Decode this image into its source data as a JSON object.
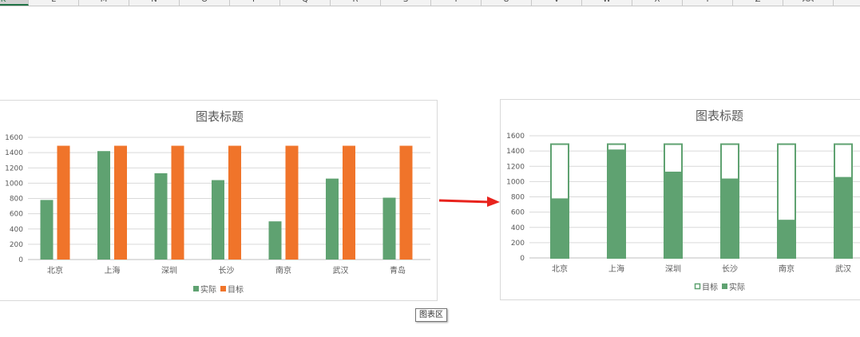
{
  "column_headers": [
    "K",
    "L",
    "M",
    "N",
    "O",
    "P",
    "Q",
    "R",
    "S",
    "T",
    "U",
    "V",
    "W",
    "X",
    "Y",
    "Z",
    "AA"
  ],
  "selected_column": "K",
  "tooltip": "图表区",
  "colors": {
    "actual": "#5fa271",
    "target": "#f0742a",
    "target_outline": "#5fa271",
    "arrow": "#e8231d",
    "grid": "#d9d9d9",
    "text": "#595959",
    "title": "#595959"
  },
  "chart_data": [
    {
      "type": "bar",
      "title": "图表标题",
      "categories": [
        "北京",
        "上海",
        "深圳",
        "长沙",
        "南京",
        "武汉",
        "青岛"
      ],
      "series": [
        {
          "name": "实际",
          "values": [
            780,
            1420,
            1130,
            1040,
            500,
            1060,
            810
          ]
        },
        {
          "name": "目标",
          "values": [
            1490,
            1490,
            1490,
            1490,
            1490,
            1490,
            1490
          ]
        }
      ],
      "yticks": [
        "0",
        "200",
        "400",
        "600",
        "800",
        "1000",
        "1200",
        "1400",
        "1600"
      ],
      "ylim": [
        0,
        1600
      ],
      "grid": true,
      "legend": "bottom",
      "legend_items": [
        "实际",
        "目标"
      ]
    },
    {
      "type": "bar",
      "subtype": "overlapped",
      "title": "图表标题",
      "categories": [
        "北京",
        "上海",
        "深圳",
        "长沙",
        "南京",
        "武汉"
      ],
      "series": [
        {
          "name": "目标",
          "values": [
            1490,
            1490,
            1490,
            1490,
            1490,
            1490
          ]
        },
        {
          "name": "实际",
          "values": [
            780,
            1420,
            1130,
            1040,
            500,
            1060
          ]
        }
      ],
      "yticks": [
        "0",
        "200",
        "400",
        "600",
        "800",
        "1000",
        "1200",
        "1400",
        "1600"
      ],
      "ylim": [
        0,
        1600
      ],
      "grid": true,
      "legend": "bottom",
      "legend_items": [
        "目标",
        "实际"
      ]
    }
  ]
}
